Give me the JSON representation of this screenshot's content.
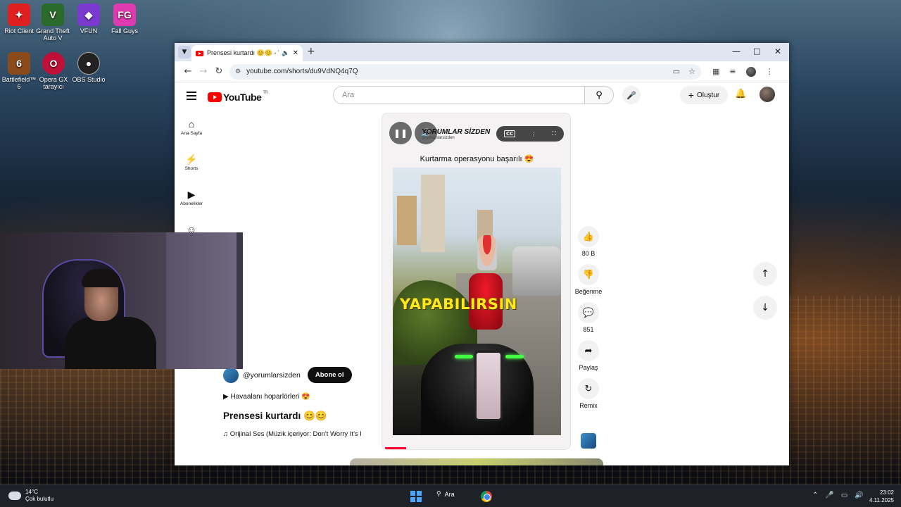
{
  "desktop": {
    "icons": [
      {
        "label": "Riot Client",
        "glyph": "✦",
        "color": "#e02020"
      },
      {
        "label": "Grand Theft Auto V",
        "glyph": "V",
        "color": "#2a6a2a"
      },
      {
        "label": "VFUN",
        "glyph": "◆",
        "color": "#7a3ad0"
      },
      {
        "label": "Fall Guys",
        "glyph": "FG",
        "color": "#e03ab0"
      },
      {
        "label": "Battlefield™ 6",
        "glyph": "6",
        "color": "#8a4a1a"
      },
      {
        "label": "Opera GX tarayıcı",
        "glyph": "O",
        "color": "#c0103a"
      },
      {
        "label": "OBS Studio",
        "glyph": "●",
        "color": "#222222"
      }
    ]
  },
  "browser": {
    "tab_title": "Prensesi kurtardı 😊😊 - YouTube",
    "url": "youtube.com/shorts/du9VdNQ4q7Q"
  },
  "youtube": {
    "logo_text": "YouTube",
    "logo_region": "TR",
    "search_placeholder": "Ara",
    "create_label": "Oluştur",
    "nav": {
      "home": "Ana Sayfa",
      "shorts": "Shorts",
      "subscriptions": "Abonelikler"
    },
    "short": {
      "channel_header": "YORUMLAR SİZDEN",
      "channel_header_handle": "@yorumlarsizden",
      "caption": "Kurtarma operasyonu başarılı 😍",
      "overlay_text": "YAPABILIRSIN",
      "cc_label": "CC"
    },
    "actions": {
      "likes": "80 B",
      "dislike": "Beğenme",
      "comments": "851",
      "share": "Paylaş",
      "remix": "Remix"
    },
    "description": {
      "handle": "@yorumlarsizden",
      "subscribe": "Abone ol",
      "line": "▶ Havaalanı hoparlörleri 😍",
      "title": "Prensesi kurtardı 😊😊",
      "music": "♫ Orijinal Ses (Müzik içeriyor: Don't Worry It's I"
    }
  },
  "taskbar": {
    "temperature": "14°C",
    "weather": "Çok bulutlu",
    "search_label": "Ara",
    "time": "23:02",
    "date": "4.11.2025"
  }
}
